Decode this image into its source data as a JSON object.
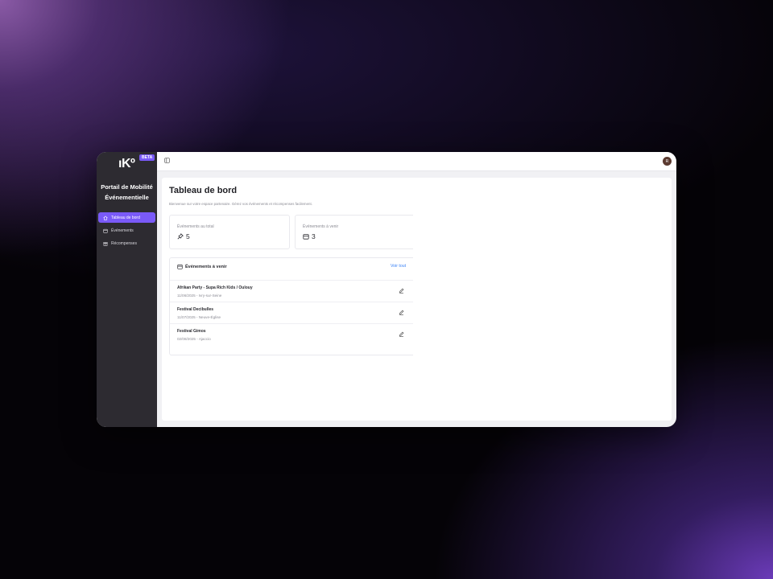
{
  "sidebar": {
    "logo_text": "IKO",
    "beta_label": "BETA",
    "brand_line1": "Portail de Mobilité",
    "brand_line2": "Événementielle",
    "items": [
      {
        "label": "Tableau de bord",
        "icon": "home-icon",
        "active": true
      },
      {
        "label": "Événements",
        "icon": "calendar-icon",
        "active": false
      },
      {
        "label": "Récompenses",
        "icon": "gift-icon",
        "active": false
      }
    ]
  },
  "topbar": {
    "menu_icon": "panel-toggle-icon",
    "avatar_initial": "R"
  },
  "main": {
    "title": "Tableau de bord",
    "subtitle": "Bienvenue sur votre espace partenaire. Gérez vos événements et récompenses facilement.",
    "stats": [
      {
        "label": "Événements au total",
        "value": "5",
        "icon": "pin-icon"
      },
      {
        "label": "Événements à venir",
        "value": "3",
        "icon": "calendar-icon"
      }
    ],
    "upcoming": {
      "title": "Événements à venir",
      "see_all": "Voir tout",
      "events": [
        {
          "name": "Afrikan Party - Supa Rich Kids / Oulouy",
          "meta": "11/06/2025 - Ivry-sur-Seine"
        },
        {
          "name": "Festival Decibulles",
          "meta": "11/07/2025 - Neuve-Église"
        },
        {
          "name": "Festival Gimos",
          "meta": "02/08/2025 - Ajaccio"
        }
      ]
    }
  },
  "colors": {
    "accent": "#7a5af8",
    "sidebar_bg": "#2d2b31",
    "link": "#3b82f6"
  }
}
